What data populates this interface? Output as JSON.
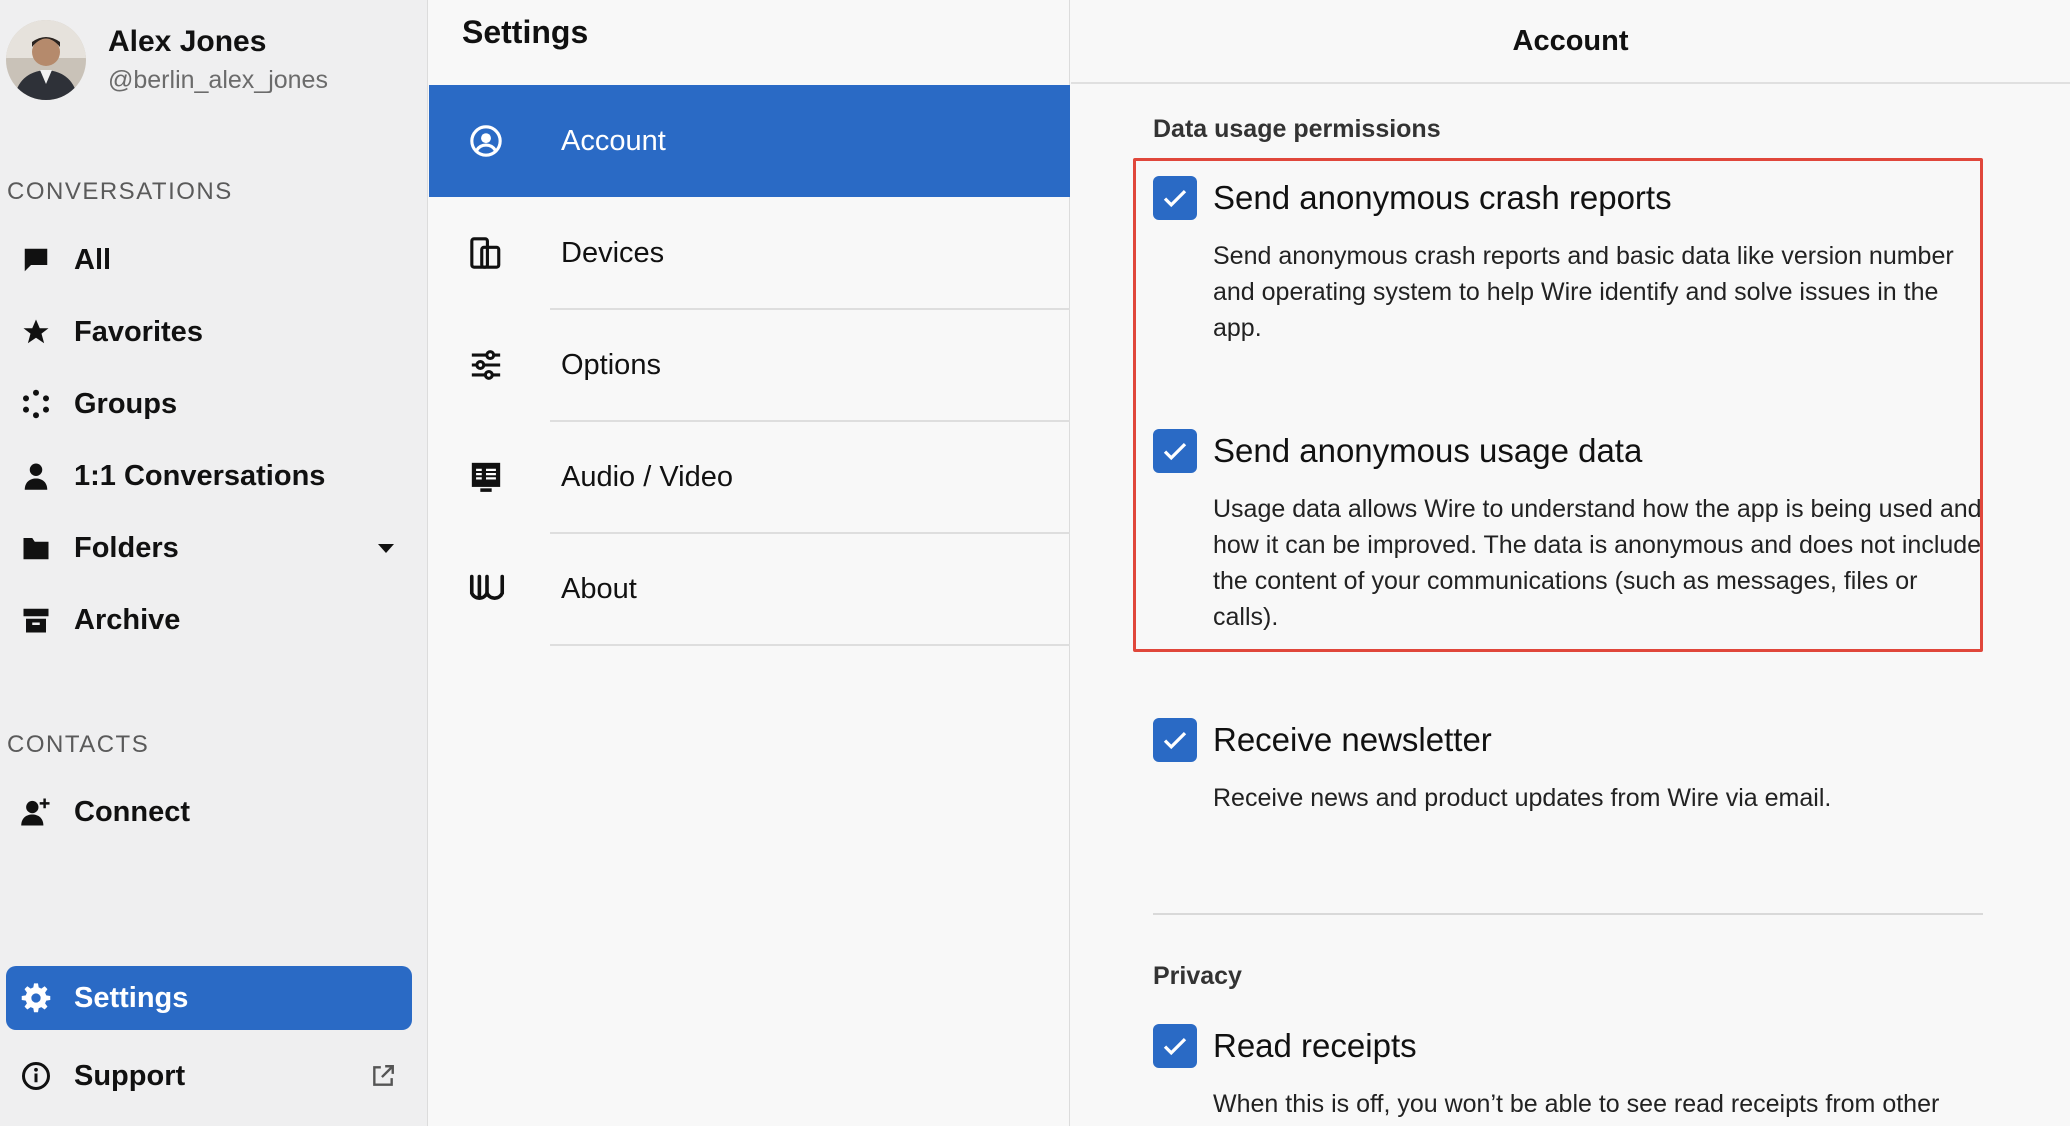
{
  "profile": {
    "name": "Alex Jones",
    "handle": "@berlin_alex_jones"
  },
  "sidebar": {
    "conversations_label": "CONVERSATIONS",
    "items": [
      {
        "label": "All",
        "icon": "chat-bubble-icon"
      },
      {
        "label": "Favorites",
        "icon": "star-icon"
      },
      {
        "label": "Groups",
        "icon": "groups-icon"
      },
      {
        "label": "1:1 Conversations",
        "icon": "person-icon"
      },
      {
        "label": "Folders",
        "icon": "folder-icon"
      },
      {
        "label": "Archive",
        "icon": "archive-icon"
      }
    ],
    "contacts_label": "CONTACTS",
    "connect_label": "Connect",
    "settings_label": "Settings",
    "support_label": "Support"
  },
  "settings": {
    "title": "Settings",
    "menu": [
      {
        "label": "Account",
        "icon": "account-icon",
        "active": true
      },
      {
        "label": "Devices",
        "icon": "devices-icon"
      },
      {
        "label": "Options",
        "icon": "sliders-icon"
      },
      {
        "label": "Audio / Video",
        "icon": "audio-video-icon"
      },
      {
        "label": "About",
        "icon": "wire-logo-icon"
      }
    ]
  },
  "account": {
    "title": "Account",
    "data_usage_title": "Data usage permissions",
    "crash_reports": {
      "label": "Send anonymous crash reports",
      "desc": "Send anonymous crash reports and basic data like version number and operating system to help Wire identify and solve issues in the app.",
      "checked": true
    },
    "usage_data": {
      "label": "Send anonymous usage data",
      "desc": "Usage data allows Wire to understand how the app is being used and how it can be improved. The data is anonymous and does not include the content of your communications (such as messages, files or calls).",
      "checked": true
    },
    "newsletter": {
      "label": "Receive newsletter",
      "desc": "Receive news and product updates from Wire via email.",
      "checked": true
    },
    "privacy_title": "Privacy",
    "read_receipts": {
      "label": "Read receipts",
      "desc": "When this is off, you won’t be able to see read receipts from other",
      "checked": true
    }
  },
  "colors": {
    "accent": "#2a6ac5",
    "highlight": "#e0473b"
  }
}
